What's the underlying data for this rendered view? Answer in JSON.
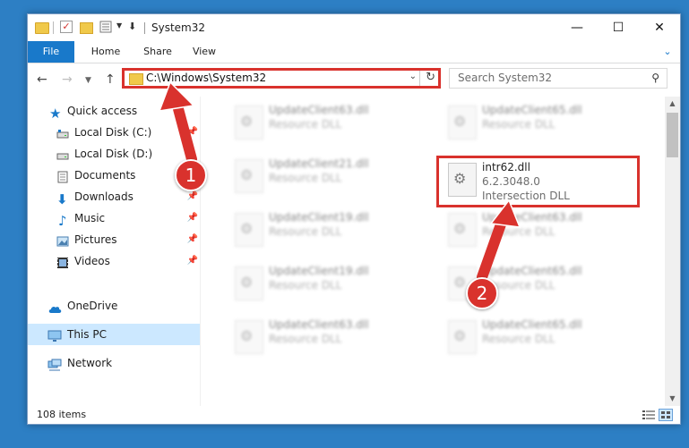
{
  "window": {
    "title": "System32",
    "controls": {
      "minimize": "—",
      "maximize": "☐",
      "close": "✕"
    }
  },
  "ribbon": {
    "file": "File",
    "home": "Home",
    "share": "Share",
    "view": "View"
  },
  "address": {
    "path": "C:\\Windows\\System32"
  },
  "search": {
    "placeholder": "Search System32"
  },
  "nav": [
    {
      "label": "Quick access",
      "icon": "star-icon",
      "pinned": false
    },
    {
      "label": "Local Disk (C:)",
      "icon": "drive-icon",
      "pinned": true
    },
    {
      "label": "Local Disk (D:)",
      "icon": "drive-icon",
      "pinned": false
    },
    {
      "label": "Documents",
      "icon": "documents-icon",
      "pinned": true
    },
    {
      "label": "Downloads",
      "icon": "downloads-icon",
      "pinned": true
    },
    {
      "label": "Music",
      "icon": "music-icon",
      "pinned": true
    },
    {
      "label": "Pictures",
      "icon": "pictures-icon",
      "pinned": true
    },
    {
      "label": "Videos",
      "icon": "videos-icon",
      "pinned": true
    },
    {
      "label": "OneDrive",
      "icon": "onedrive-icon",
      "pinned": false
    },
    {
      "label": "This PC",
      "icon": "pc-icon",
      "pinned": false
    },
    {
      "label": "Network",
      "icon": "network-icon",
      "pinned": false
    }
  ],
  "files": [
    {
      "name": "UpdateClient63.dll",
      "desc": "Resource DLL"
    },
    {
      "name": "UpdateClient65.dll",
      "desc": "Resource DLL"
    },
    {
      "name": "UpdateClient21.dll",
      "desc": "Resource DLL"
    },
    {
      "name": "intr62.dll",
      "version": "6.2.3048.0",
      "desc": "Intersection DLL"
    },
    {
      "name": "UpdateClient19.dll",
      "desc": "Resource DLL"
    },
    {
      "name": "UpdateClient63.dll",
      "desc": "Resource DLL"
    },
    {
      "name": "UpdateClient19.dll",
      "desc": "Resource DLL"
    },
    {
      "name": "UpdateClient65.dll",
      "desc": "Resource DLL"
    },
    {
      "name": "UpdateClient63.dll",
      "desc": "Resource DLL"
    },
    {
      "name": "UpdateClient65.dll",
      "desc": "Resource DLL"
    }
  ],
  "status": {
    "count": "108 items"
  },
  "callouts": {
    "one": "1",
    "two": "2"
  },
  "colors": {
    "accent": "#1979ca",
    "highlight": "#d9322d",
    "selection": "#cce8ff"
  }
}
